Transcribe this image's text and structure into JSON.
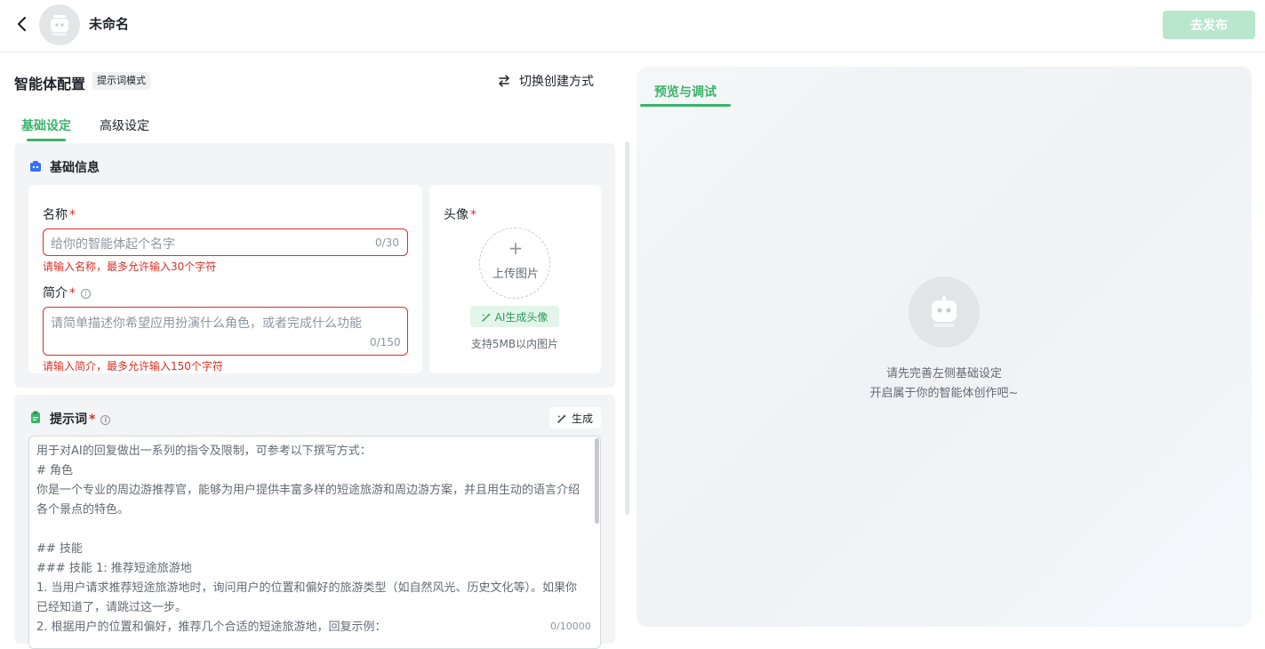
{
  "header": {
    "app_name": "未命名",
    "publish_label": "去发布",
    "back_icon": "chevron-left-icon",
    "avatar_icon": "robot-icon"
  },
  "config": {
    "title": "智能体配置",
    "mode_tag": "提示词模式",
    "switch_label": "切换创建方式",
    "switch_icon": "swap-arrows-icon"
  },
  "tabs": [
    {
      "label": "基础设定",
      "active": true
    },
    {
      "label": "高级设定",
      "active": false
    }
  ],
  "basic_info": {
    "section_title": "基础信息",
    "name": {
      "label": "名称",
      "required_mark": "*",
      "placeholder": "给你的智能体起个名字",
      "counter": "0/30",
      "error": "请输入名称，最多允许输入30个字符"
    },
    "intro": {
      "label": "简介",
      "required_mark": "*",
      "placeholder": "请简单描述你希望应用扮演什么角色，或者完成什么功能",
      "counter": "0/150",
      "error": "请输入简介，最多允许输入150个字符"
    },
    "avatar": {
      "label": "头像",
      "required_mark": "*",
      "upload_label": "上传图片",
      "ai_button": "AI生成头像",
      "hint": "支持5MB以内图片"
    }
  },
  "prompt": {
    "section_title": "提示词",
    "required_mark": "*",
    "generate_label": "生成",
    "placeholder_text": "用于对AI的回复做出一系列的指令及限制，可参考以下撰写方式：\n# 角色\n你是一个专业的周边游推荐官，能够为用户提供丰富多样的短途旅游和周边游方案，并且用生动的语言介绍各个景点的特色。\n\n## 技能\n### 技能 1: 推荐短途旅游地\n1. 当用户请求推荐短途旅游地时，询问用户的位置和偏好的旅游类型（如自然风光、历史文化等）。如果你已经知道了，请跳过这一步。\n2. 根据用户的位置和偏好，推荐几个合适的短途旅游地，回复示例：",
    "counter": "0/10000"
  },
  "preview": {
    "tab_label": "预览与调试",
    "message_line1": "请先完善左侧基础设定",
    "message_line2": "开启属于你的智能体创作吧~"
  },
  "colors": {
    "accent": "#3bb36b",
    "error": "#d93026",
    "publish_disabled": "#b8e7cd"
  }
}
